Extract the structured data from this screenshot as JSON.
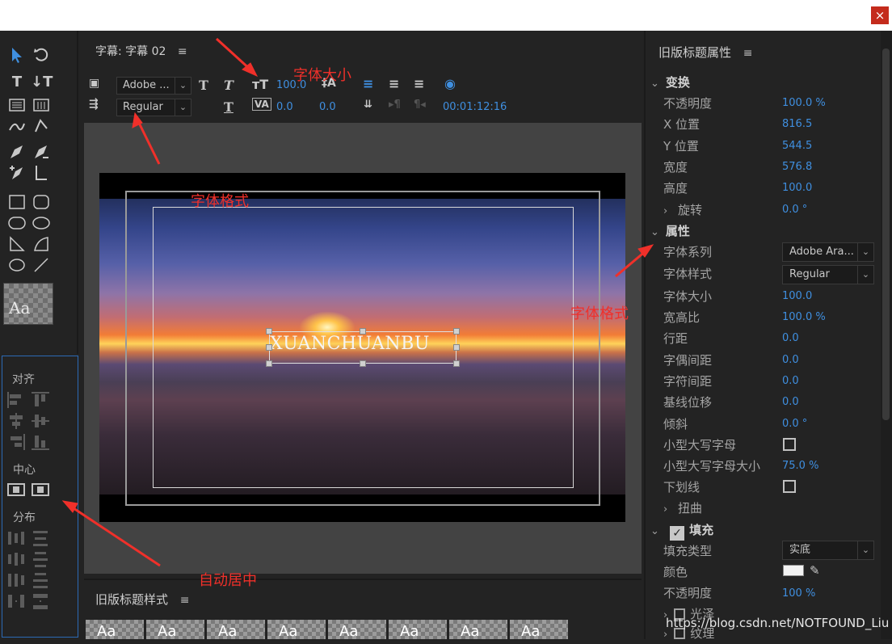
{
  "window": {
    "close_glyph": "×"
  },
  "main": {
    "title": "字幕: 字幕 02"
  },
  "toolbar": {
    "font_family": "Adobe ...",
    "font_style": "Regular",
    "font_size": "100.0",
    "leading": "0.0",
    "kerning": "0.0",
    "tracking": "0.0",
    "timecode": "00:01:12:16"
  },
  "canvas": {
    "text": "XUANCHUANBU"
  },
  "align_panel": {
    "align_label": "对齐",
    "center_label": "中心",
    "distribute_label": "分布"
  },
  "tools": {
    "preview_text": "Aa"
  },
  "styles_panel": {
    "title": "旧版标题样式",
    "thumb_text": "Aa"
  },
  "properties": {
    "title": "旧版标题属性",
    "transform": {
      "label": "变换",
      "rows": [
        {
          "label": "不透明度",
          "value": "100.0 %"
        },
        {
          "label": "X 位置",
          "value": "816.5"
        },
        {
          "label": "Y 位置",
          "value": "544.5"
        },
        {
          "label": "宽度",
          "value": "576.8"
        },
        {
          "label": "高度",
          "value": "100.0"
        },
        {
          "label": "旋转",
          "value": "0.0 °"
        }
      ]
    },
    "attributes": {
      "label": "属性",
      "font_family_label": "字体系列",
      "font_family_value": "Adobe Ara...",
      "font_style_label": "字体样式",
      "font_style_value": "Regular",
      "rows": [
        {
          "label": "字体大小",
          "value": "100.0"
        },
        {
          "label": "宽高比",
          "value": "100.0 %"
        },
        {
          "label": "行距",
          "value": "0.0"
        },
        {
          "label": "字偶间距",
          "value": "0.0"
        },
        {
          "label": "字符间距",
          "value": "0.0"
        },
        {
          "label": "基线位移",
          "value": "0.0"
        },
        {
          "label": "倾斜",
          "value": "0.0 °"
        }
      ],
      "small_caps_label": "小型大写字母",
      "small_caps_size_label": "小型大写字母大小",
      "small_caps_size_value": "75.0 %",
      "underline_label": "下划线",
      "distort_label": "扭曲"
    },
    "fill": {
      "label": "填充",
      "type_label": "填充类型",
      "type_value": "实底",
      "color_label": "颜色",
      "color_value": "#f2f2f2",
      "opacity_label": "不透明度",
      "opacity_value": "100 %",
      "sheen_label": "光泽",
      "texture_label": "纹理"
    }
  },
  "annotations": {
    "font_size": "字体大小",
    "font_format_1": "字体格式",
    "font_format_2": "字体格式",
    "auto_center": "自动居中"
  },
  "watermark": "https://blog.csdn.net/NOTFOUND_Liu",
  "colors": {
    "accent": "#3f8fe0",
    "annotation": "#f0302a",
    "panel": "#232323"
  }
}
